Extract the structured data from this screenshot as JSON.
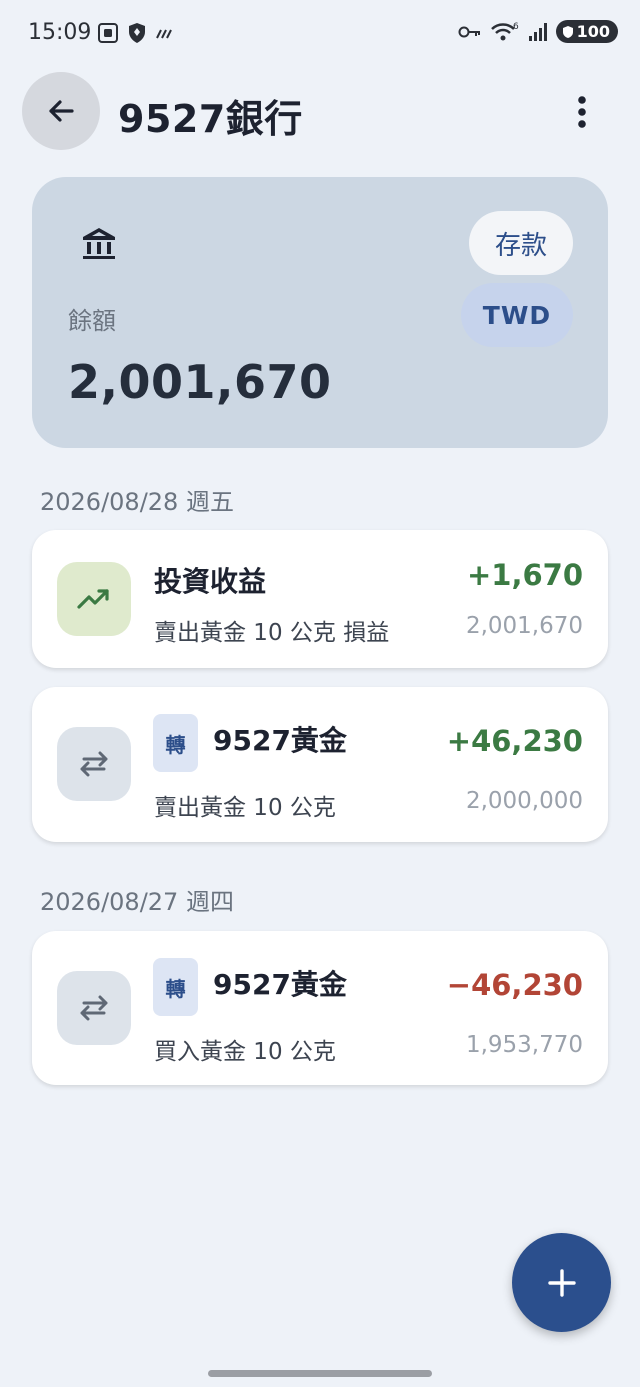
{
  "status_bar": {
    "time": "15:09",
    "battery": "100",
    "signal_sup": "6"
  },
  "app_bar": {
    "title": "9527銀行"
  },
  "account": {
    "balance_label": "餘額",
    "balance": "2,001,670",
    "type_chip": "存款",
    "currency_chip": "TWD"
  },
  "groups": [
    {
      "date": "2026/08/28 週五",
      "transactions": [
        {
          "icon": "trending-up-icon",
          "title": "投資收益",
          "subtitle": "賣出黃金 10 公克 損益",
          "amount": "+1,670",
          "balance": "2,001,670"
        },
        {
          "icon": "transfer-icon",
          "badge": "轉",
          "title": "9527黃金",
          "subtitle": "賣出黃金 10 公克",
          "amount": "+46,230",
          "balance": "2,000,000"
        }
      ]
    },
    {
      "date": "2026/08/27 週四",
      "transactions": [
        {
          "icon": "transfer-icon",
          "badge": "轉",
          "title": "9527黃金",
          "subtitle": "買入黃金 10 公克",
          "amount": "−46,230",
          "balance": "1,953,770"
        }
      ]
    }
  ],
  "colors": {
    "positive": "#3b7a43",
    "negative": "#b24536",
    "accent": "#2b4f8d"
  }
}
